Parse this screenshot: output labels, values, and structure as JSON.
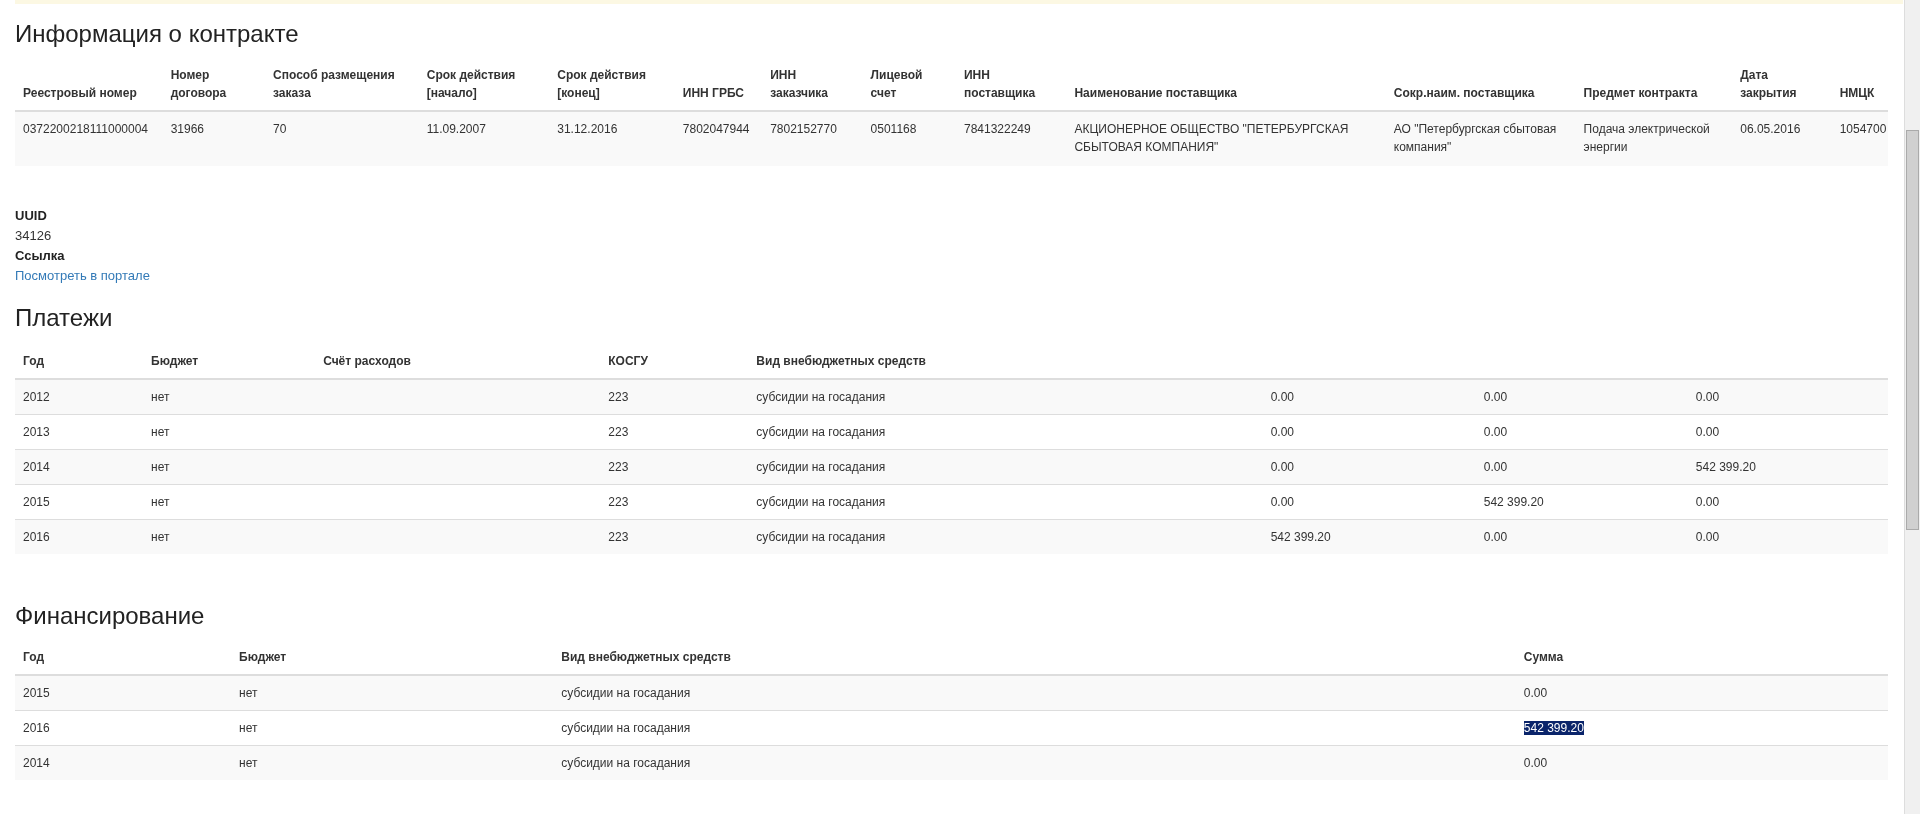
{
  "contract": {
    "title": "Информация о контракте",
    "columns": [
      "Реестровый номер",
      "Номер договора",
      "Способ размещения заказа",
      "Срок действия [начало]",
      "Срок действия [конец]",
      "ИНН ГРБС",
      "ИНН заказчика",
      "Лицевой счет",
      "ИНН поставщика",
      "Наименование поставщика",
      "Сокр.наим. поставщика",
      "Предмет контракта",
      "Дата закрытия",
      "НМЦК"
    ],
    "rows": [
      [
        "0372200218111000004",
        "31966",
        "70",
        "11.09.2007",
        "31.12.2016",
        "7802047944",
        "7802152770",
        "0501168",
        "7841322249",
        "АКЦИОНЕРНОЕ ОБЩЕСТВО \"ПЕТЕРБУРГСКАЯ СБЫТОВАЯ КОМПАНИЯ\"",
        "АО \"Петербургская сбытовая компания\"",
        "Подача электрической энергии",
        "06.05.2016",
        "1054700"
      ]
    ]
  },
  "details": [
    {
      "label": "UUID",
      "value": "34126",
      "kind": "text"
    },
    {
      "label": "Ссылка",
      "value": "Посмотреть в портале",
      "kind": "link"
    }
  ],
  "payments": {
    "title": "Платежи",
    "columns": [
      "Год",
      "Бюджет",
      "Счёт расходов",
      "КОСГУ",
      "Вид внебюджетных средств"
    ],
    "rows": [
      {
        "year": "2012",
        "budget": "нет",
        "kosgu": "223",
        "funds": "субсидии на госадания",
        "column_6": "0.00",
        "column_7": "0.00",
        "column_8": "0.00"
      },
      {
        "year": "2013",
        "budget": "нет",
        "kosgu": "223",
        "funds": "субсидии на госадания",
        "column_6": "0.00",
        "column_7": "0.00",
        "column_8": "0.00"
      },
      {
        "year": "2014",
        "budget": "нет",
        "kosgu": "223",
        "funds": "субсидии на госадания",
        "column_6": "0.00",
        "column_7": "0.00",
        "column_8": "542 399.20"
      },
      {
        "year": "2015",
        "budget": "нет",
        "kosgu": "223",
        "funds": "субсидии на госадания",
        "column_6": "0.00",
        "column_7": "542 399.20",
        "column_8": "0.00"
      },
      {
        "year": "2016",
        "budget": "нет",
        "kosgu": "223",
        "funds": "субсидии на госадания",
        "column_6": "542 399.20",
        "column_7": "0.00",
        "column_8": "0.00"
      }
    ]
  },
  "financing": {
    "title": "Финансирование",
    "columns": [
      "Год",
      "Бюджет",
      "Вид внебюджетных средств",
      "Сумма"
    ],
    "rows": [
      {
        "year": "2015",
        "budget": "нет",
        "funds": "субсидии на госадания",
        "sum": "0.00",
        "highlighted": false
      },
      {
        "year": "2016",
        "budget": "нет",
        "funds": "субсидии на госадания",
        "sum": "542 399.20",
        "highlighted": true
      },
      {
        "year": "2014",
        "budget": "нет",
        "funds": "субсидии на госадания",
        "sum": "0.00",
        "highlighted": false
      }
    ]
  }
}
